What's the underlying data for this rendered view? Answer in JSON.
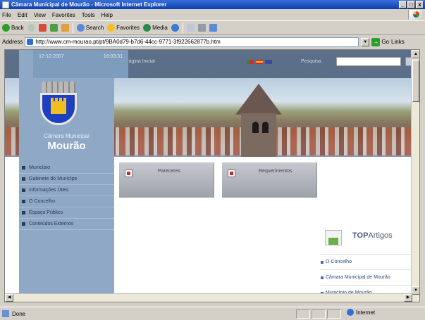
{
  "window": {
    "title": "Câmara Municipal de Mourão - Microsoft Internet Explorer",
    "min_label": "_",
    "max_label": "□",
    "close_label": "x"
  },
  "menu": [
    "File",
    "Edit",
    "View",
    "Favorites",
    "Tools",
    "Help"
  ],
  "toolbar": {
    "back": "Back",
    "search": "Search",
    "favorites": "Favorites",
    "media": "Media"
  },
  "address": {
    "label": "Address",
    "url": "http://www.cm-mourao.pt/pt/9BA0d79-b7d6-44cc-9771-3f922662877b.htm",
    "go": "Go",
    "links": "Links"
  },
  "page": {
    "date": "12-12-2007",
    "time": "18:03:31",
    "home_link": "Página Inicial",
    "search_label": "Pesquisa",
    "search_value": "",
    "town_small": "Câmara Municipal",
    "town_big": "Mourão",
    "sidebar_menu": [
      "Município",
      "Gabinete do Munícipe",
      "Informações Úteis",
      "O Concelho",
      "Espaço Público",
      "Conteúdos Externos"
    ],
    "tiles": [
      "Pareceres",
      "Requerimentos"
    ],
    "top_title_bold": "TOP",
    "top_title_rest": "Artigos",
    "top_items": [
      "O Concelho",
      "Câmara Municipal de Mourão",
      "Município de Mourão"
    ]
  },
  "status": {
    "text": "Done",
    "zone": "Internet"
  },
  "colors": {
    "sidebar": "#8ea8c6",
    "header": "#5c6f88",
    "tile": "#b4b8c0",
    "accent": "#1e3fbf"
  }
}
